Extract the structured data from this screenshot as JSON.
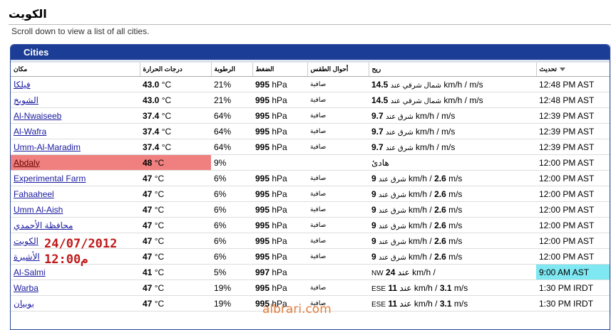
{
  "page": {
    "title": "الكويت",
    "subtitle": "Scroll down to view a list of all cities."
  },
  "panel": {
    "title": "Cities"
  },
  "columns": {
    "city": "مكان",
    "temp": "درجات الحرارة",
    "humidity": "الرطوبة",
    "pressure": "الضغط",
    "conditions": "أحوال الطقس",
    "wind": "ريح",
    "updated": "تحديث"
  },
  "rows": [
    {
      "city": "فيلكا",
      "temp": "43.0",
      "temp_unit": "°C",
      "humidity": "21%",
      "pressure": "995",
      "pressure_unit": "hPa",
      "conditions": "صافية",
      "wind_dir": "شمال شرقي عند",
      "wind_kmh": "14.5",
      "wind_kmh_unit": "km/h /",
      "wind_ms": "",
      "wind_ms_unit": "m/s",
      "updated": "12:48 PM AST"
    },
    {
      "city": "الشويخ",
      "temp": "43.0",
      "temp_unit": "°C",
      "humidity": "21%",
      "pressure": "995",
      "pressure_unit": "hPa",
      "conditions": "صافية",
      "wind_dir": "شمال شرقي عند",
      "wind_kmh": "14.5",
      "wind_kmh_unit": "km/h /",
      "wind_ms": "",
      "wind_ms_unit": "m/s",
      "updated": "12:48 PM AST"
    },
    {
      "city": "Al-Nwaiseeb",
      "temp": "37.4",
      "temp_unit": "°C",
      "humidity": "64%",
      "pressure": "995",
      "pressure_unit": "hPa",
      "conditions": "صافية",
      "wind_dir": "شرق عند",
      "wind_kmh": "9.7",
      "wind_kmh_unit": "km/h /",
      "wind_ms": "",
      "wind_ms_unit": "m/s",
      "updated": "12:39 PM AST"
    },
    {
      "city": "Al-Wafra",
      "temp": "37.4",
      "temp_unit": "°C",
      "humidity": "64%",
      "pressure": "995",
      "pressure_unit": "hPa",
      "conditions": "صافية",
      "wind_dir": "شرق عند",
      "wind_kmh": "9.7",
      "wind_kmh_unit": "km/h /",
      "wind_ms": "",
      "wind_ms_unit": "m/s",
      "updated": "12:39 PM AST"
    },
    {
      "city": "Umm-Al-Maradim",
      "temp": "37.4",
      "temp_unit": "°C",
      "humidity": "64%",
      "pressure": "995",
      "pressure_unit": "hPa",
      "conditions": "صافية",
      "wind_dir": "شرق عند",
      "wind_kmh": "9.7",
      "wind_kmh_unit": "km/h /",
      "wind_ms": "",
      "wind_ms_unit": "m/s",
      "updated": "12:39 PM AST"
    },
    {
      "city": "Abdaly",
      "temp": "48",
      "temp_unit": "°C",
      "humidity": "9%",
      "pressure": "",
      "pressure_unit": "",
      "conditions": "",
      "wind_dir": "",
      "wind_kmh": "",
      "wind_kmh_unit": "هادئ",
      "wind_ms": "",
      "wind_ms_unit": "",
      "updated": "12:00 PM AST",
      "highlight": true
    },
    {
      "city": "Experimental Farm",
      "temp": "47",
      "temp_unit": "°C",
      "humidity": "6%",
      "pressure": "995",
      "pressure_unit": "hPa",
      "conditions": "صافية",
      "wind_dir": "شرق عند",
      "wind_kmh": "9",
      "wind_kmh_unit": "km/h /",
      "wind_ms": "2.6",
      "wind_ms_unit": "m/s",
      "updated": "12:00 PM AST"
    },
    {
      "city": "Fahaaheel",
      "temp": "47",
      "temp_unit": "°C",
      "humidity": "6%",
      "pressure": "995",
      "pressure_unit": "hPa",
      "conditions": "صافية",
      "wind_dir": "شرق عند",
      "wind_kmh": "9",
      "wind_kmh_unit": "km/h /",
      "wind_ms": "2.6",
      "wind_ms_unit": "m/s",
      "updated": "12:00 PM AST"
    },
    {
      "city": "Umm Al-Aish",
      "temp": "47",
      "temp_unit": "°C",
      "humidity": "6%",
      "pressure": "995",
      "pressure_unit": "hPa",
      "conditions": "صافية",
      "wind_dir": "شرق عند",
      "wind_kmh": "9",
      "wind_kmh_unit": "km/h /",
      "wind_ms": "2.6",
      "wind_ms_unit": "m/s",
      "updated": "12:00 PM AST"
    },
    {
      "city": "محافظة الأحمدي",
      "temp": "47",
      "temp_unit": "°C",
      "humidity": "6%",
      "pressure": "995",
      "pressure_unit": "hPa",
      "conditions": "صافية",
      "wind_dir": "شرق عند",
      "wind_kmh": "9",
      "wind_kmh_unit": "km/h /",
      "wind_ms": "2.6",
      "wind_ms_unit": "m/s",
      "updated": "12:00 PM AST"
    },
    {
      "city": "الكويت",
      "temp": "47",
      "temp_unit": "°C",
      "humidity": "6%",
      "pressure": "995",
      "pressure_unit": "hPa",
      "conditions": "صافية",
      "wind_dir": "شرق عند",
      "wind_kmh": "9",
      "wind_kmh_unit": "km/h /",
      "wind_ms": "2.6",
      "wind_ms_unit": "m/s",
      "updated": "12:00 PM AST"
    },
    {
      "city": "الأشيرة",
      "temp": "47",
      "temp_unit": "°C",
      "humidity": "6%",
      "pressure": "995",
      "pressure_unit": "hPa",
      "conditions": "صافية",
      "wind_dir": "شرق عند",
      "wind_kmh": "9",
      "wind_kmh_unit": "km/h /",
      "wind_ms": "2.6",
      "wind_ms_unit": "m/s",
      "updated": "12:00 PM AST"
    },
    {
      "city": "Al-Salmi",
      "temp": "41",
      "temp_unit": "°C",
      "humidity": "5%",
      "pressure": "997",
      "pressure_unit": "hPa",
      "conditions": "",
      "wind_dir": "NW",
      "wind_kmh": "24",
      "wind_kmh_unit": "عند km/h /",
      "wind_ms": "",
      "wind_ms_unit": "",
      "updated": "9:00 AM AST",
      "updated_highlight": true
    },
    {
      "city": "Warba",
      "temp": "47",
      "temp_unit": "°C",
      "humidity": "19%",
      "pressure": "995",
      "pressure_unit": "hPa",
      "conditions": "صافية",
      "wind_dir": "ESE",
      "wind_kmh": "11",
      "wind_kmh_unit": "عند km/h /",
      "wind_ms": "3.1",
      "wind_ms_unit": "m/s",
      "updated": "1:30 PM IRDT"
    },
    {
      "city": "بوبيان",
      "temp": "47",
      "temp_unit": "°C",
      "humidity": "19%",
      "pressure": "995",
      "pressure_unit": "hPa",
      "conditions": "صافية",
      "wind_dir": "ESE",
      "wind_kmh": "11",
      "wind_kmh_unit": "عند km/h /",
      "wind_ms": "3.1",
      "wind_ms_unit": "m/s",
      "updated": "1:30 PM IRDT"
    }
  ],
  "stamp": {
    "date": "24/07/2012",
    "time": "12:00م"
  },
  "watermark": "albrari.com",
  "colors": {
    "header_blue": "#1c3d96",
    "highlight_red": "#f08080",
    "highlight_cyan": "#7fe8f2",
    "stamp_red": "#c01818",
    "watermark_orange": "#e06a1f"
  }
}
